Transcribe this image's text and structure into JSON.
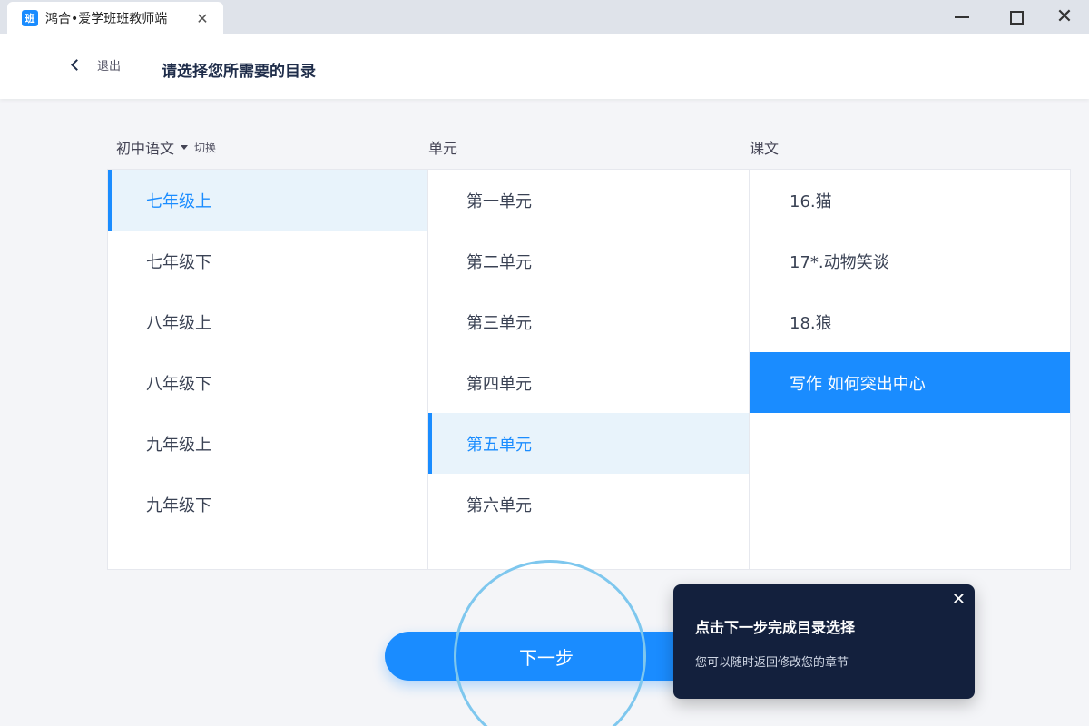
{
  "window": {
    "tab_logo": "班",
    "tab_title": "鸿合•爱学班班教师端",
    "tab_close_glyph": "✕",
    "close_glyph": "✕"
  },
  "header": {
    "back_label": "退出",
    "title": "请选择您所需要的目录"
  },
  "columns": {
    "subject": "初中语文",
    "switch_label": "切换",
    "unit_header": "单元",
    "lesson_header": "课文"
  },
  "grades": [
    "七年级上",
    "七年级下",
    "八年级上",
    "八年级下",
    "九年级上",
    "九年级下"
  ],
  "units": [
    "第一单元",
    "第二单元",
    "第三单元",
    "第四单元",
    "第五单元",
    "第六单元"
  ],
  "lessons": [
    "16.猫",
    "17*.动物笑谈",
    "18.狼",
    "写作 如何突出中心"
  ],
  "selection": {
    "grade": "七年级上",
    "unit": "第五单元",
    "lesson": "写作 如何突出中心"
  },
  "next_button": "下一步",
  "tooltip": {
    "close_glyph": "✕",
    "title": "点击下一步完成目录选择",
    "subtitle": "您可以随时返回修改您的章节"
  },
  "colors": {
    "accent": "#1a8cff",
    "active_bg": "#e8f3fb",
    "tooltip_bg": "#13203d"
  }
}
